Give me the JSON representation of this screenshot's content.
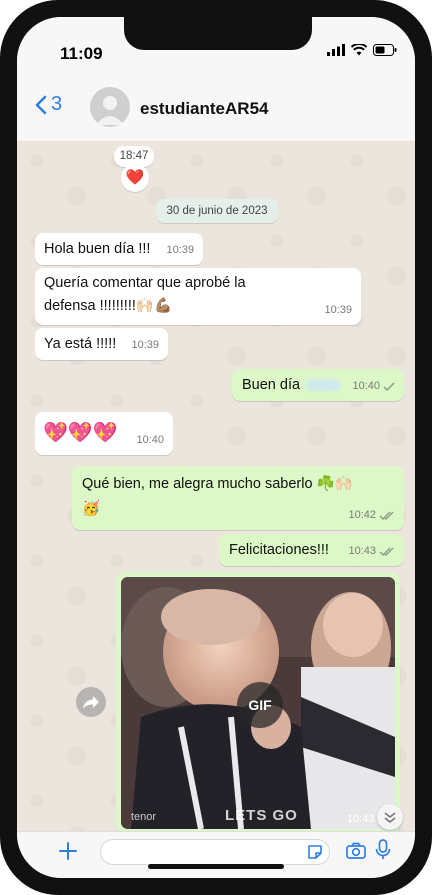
{
  "status_bar": {
    "time": "11:09"
  },
  "header": {
    "back_count": "3",
    "contact_name": "estudianteAR54"
  },
  "chat": {
    "first_reaction": {
      "time": "18:47",
      "emoji": "❤️"
    },
    "date_separator": "30 de junio de 2023",
    "messages": [
      {
        "direction": "in",
        "text": "Hola buen día !!!",
        "time": "10:39"
      },
      {
        "direction": "in",
        "text_line1": "Quería comentar que aprobé la",
        "text_line2": "defensa !!!!!!!!!🙌🏻💪🏽",
        "time": "10:39"
      },
      {
        "direction": "in",
        "text": "Ya está !!!!!",
        "time": "10:39"
      },
      {
        "direction": "out",
        "text": "Buen día",
        "time": "10:40"
      },
      {
        "direction": "in",
        "text": "💖💖💖",
        "time": "10:40"
      },
      {
        "direction": "out",
        "text_line1": "Qué bien, me alegra mucho saberlo ☘️🙌🏻",
        "text_line2": "🥳",
        "time": "10:42"
      },
      {
        "direction": "out",
        "text": "Felicitaciones!!!",
        "time": "10:43"
      }
    ],
    "gif_message": {
      "badge": "GIF",
      "provider": "tenor",
      "caption": "LETS GO",
      "time": "10:43"
    }
  },
  "colors": {
    "accent": "#2f7fe0",
    "outgoing_bubble": "#dcf8c6",
    "incoming_bubble": "#ffffff",
    "chat_bg": "#ece5dd"
  }
}
